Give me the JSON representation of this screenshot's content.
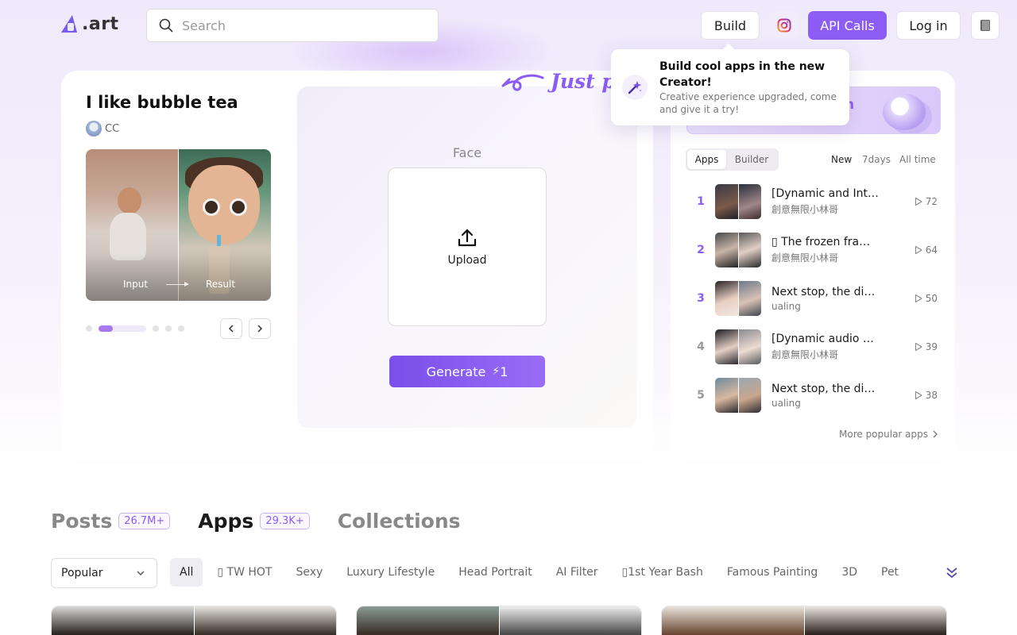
{
  "header": {
    "logo_text": ".art",
    "search_placeholder": "Search",
    "build": "Build",
    "api_calls": "API Calls",
    "login": "Log in"
  },
  "app": {
    "title": "I like bubble tea",
    "author": "CC",
    "preview_input": "Input",
    "preview_result": "Result",
    "face_label": "Face",
    "upload_label": "Upload",
    "generate_label": "Generate",
    "generate_cost": "1",
    "just_text": "Just p"
  },
  "tooltip": {
    "title": "Build cool apps in the new Creator!",
    "desc": "Creative experience upgraded, come and give it a try!"
  },
  "ranking": {
    "banner_text": "n",
    "tab_apps": "Apps",
    "tab_builder": "Builder",
    "filters": [
      "New",
      "7days",
      "All time"
    ],
    "items": [
      {
        "rank": "1",
        "title": "[Dynamic and Int…",
        "author": "創意無限小林哥",
        "plays": "72"
      },
      {
        "rank": "2",
        "title": "▯ The frozen fra…",
        "author": "創意無限小林哥",
        "plays": "64"
      },
      {
        "rank": "3",
        "title": "Next stop, the di…",
        "author": "ualing",
        "plays": "50"
      },
      {
        "rank": "4",
        "title": "[Dynamic audio …",
        "author": "創意無限小林哥",
        "plays": "39"
      },
      {
        "rank": "5",
        "title": "Next stop, the di…",
        "author": "ualing",
        "plays": "38"
      }
    ],
    "more": "More popular apps"
  },
  "section": {
    "tabs": [
      {
        "label": "Posts",
        "count": "26.7M+"
      },
      {
        "label": "Apps",
        "count": "29.3K+"
      },
      {
        "label": "Collections",
        "count": ""
      }
    ],
    "sort_value": "Popular",
    "chips": [
      "All",
      "▯ TW HOT",
      "Sexy",
      "Luxury Lifestyle",
      "Head Portrait",
      "AI Filter",
      "▯1st Year Bash",
      "Famous Painting",
      "3D",
      "Pet"
    ]
  },
  "colors": {
    "accent": "#8b5cf6",
    "accent_dark": "#7a4fea"
  }
}
